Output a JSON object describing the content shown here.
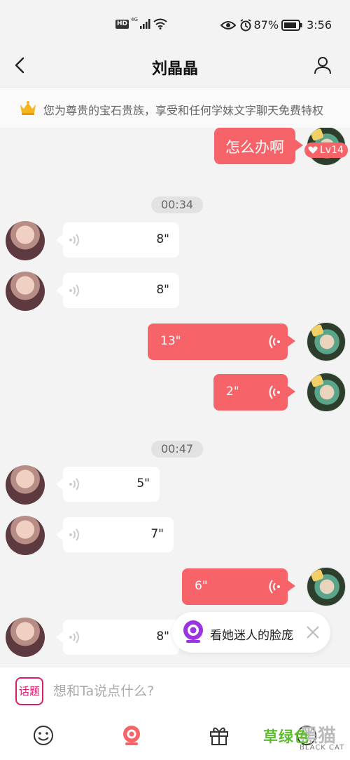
{
  "status_bar": {
    "network_badge": "HD",
    "network_type": "4G",
    "battery": "87%",
    "time": "3:56"
  },
  "header": {
    "title": "刘晶晶"
  },
  "vip_banner": {
    "text": "您为尊贵的宝石贵族，享受和任何学妹文字聊天免费特权"
  },
  "chat": {
    "first_sent_text": "怎么办啊",
    "level_badge": "Lv14",
    "timestamps": [
      "00:34",
      "00:47"
    ],
    "voice_messages": [
      {
        "side": "received",
        "duration": "8\""
      },
      {
        "side": "received",
        "duration": "8\""
      },
      {
        "side": "sent",
        "duration": "13\""
      },
      {
        "side": "sent",
        "duration": "2\""
      },
      {
        "side": "received",
        "duration": "5\""
      },
      {
        "side": "received",
        "duration": "7\""
      },
      {
        "side": "sent",
        "duration": "6\""
      },
      {
        "side": "received",
        "duration": "8\""
      }
    ]
  },
  "popup": {
    "text": "看她迷人的脸庞"
  },
  "input_bar": {
    "topic_label": "话题",
    "placeholder": "想和Ta说点什么?"
  },
  "watermark": {
    "brand": "草绿色",
    "sub": "BLACK CAT"
  },
  "colors": {
    "accent": "#f6646a",
    "topic": "#d81e6a",
    "popup_icon": "#9a35e0"
  },
  "icons": [
    "back-icon",
    "profile-icon",
    "crown-icon",
    "voice-wave-icon",
    "emoji-icon",
    "camera-icon",
    "gift-icon",
    "close-icon"
  ]
}
